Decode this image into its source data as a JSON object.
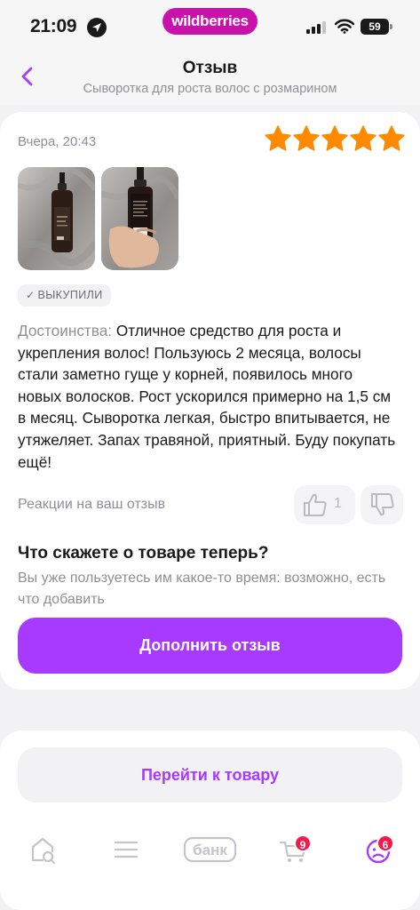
{
  "status_bar": {
    "time": "21:09",
    "brand": "wildberries",
    "battery": "59"
  },
  "header": {
    "title": "Отзыв",
    "subtitle": "Сыворотка для роста волос с розмарином"
  },
  "review": {
    "date": "Вчера, 20:43",
    "rating": 5,
    "photos": [
      "product-photo-1",
      "product-photo-2"
    ],
    "badge": "ВЫКУПИЛИ",
    "text_label": "Достоинства:",
    "text_body": " Отличное средство для роста и укрепления волос! Пользуюсь 2 месяца, волосы стали заметно гуще у корней, появилось много новых волосков. Рост ускорился примерно на 1,5 см в месяц. Сыворотка легкая, быстро впитывается, не утяжеляет. Запах травяной, приятный. Буду покупать ещё!",
    "reactions_label": "Реакции на ваш отзыв",
    "likes": "1"
  },
  "followup": {
    "title": "Что скажете о товаре теперь?",
    "subtitle": "Вы уже пользуетесь им какое-то время: возможно, есть что добавить",
    "button": "Дополнить отзыв"
  },
  "goto_product": {
    "button": "Перейти к товару"
  },
  "tabbar": {
    "items": [
      {
        "icon": "home-search-icon"
      },
      {
        "icon": "menu-icon"
      },
      {
        "icon": "bank-icon",
        "label": "банк"
      },
      {
        "icon": "cart-icon",
        "badge": "9"
      },
      {
        "icon": "profile-icon",
        "badge": "6"
      }
    ]
  },
  "colors": {
    "accent": "#a73afd",
    "brand": "#cb11ab",
    "star": "#ff8a00",
    "badge": "#f5184a"
  }
}
